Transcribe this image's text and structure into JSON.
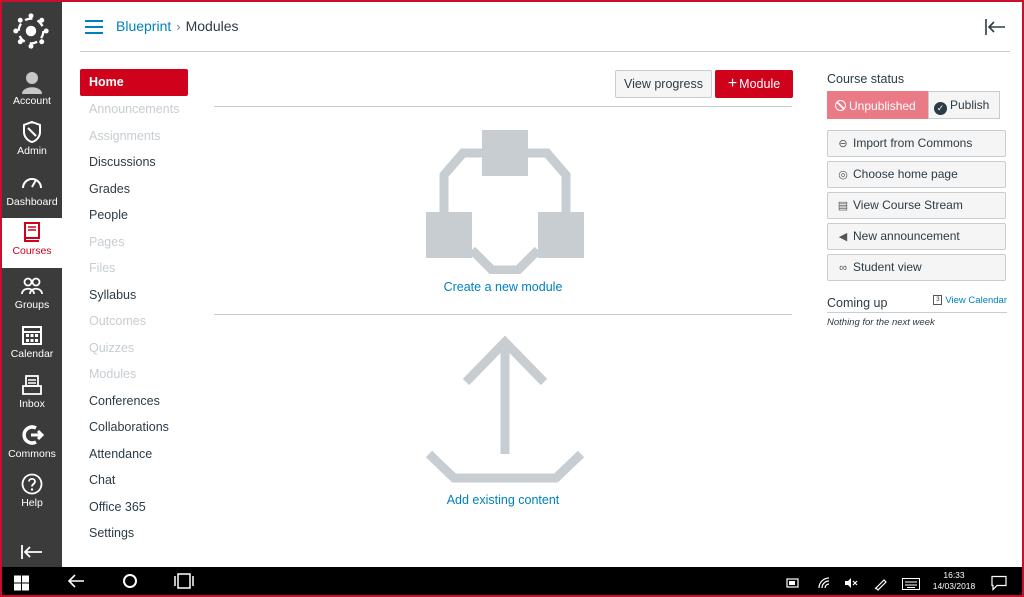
{
  "global_nav": {
    "items": [
      {
        "label": "Account",
        "icon": "user-icon"
      },
      {
        "label": "Admin",
        "icon": "shield-icon"
      },
      {
        "label": "Dashboard",
        "icon": "speedometer-icon"
      },
      {
        "label": "Courses",
        "icon": "book-icon"
      },
      {
        "label": "Groups",
        "icon": "group-icon"
      },
      {
        "label": "Calendar",
        "icon": "calendar-icon"
      },
      {
        "label": "Inbox",
        "icon": "inbox-icon"
      },
      {
        "label": "Commons",
        "icon": "commons-icon"
      },
      {
        "label": "Help",
        "icon": "help-icon"
      }
    ],
    "active": "Courses",
    "accent_color": "#d0021b"
  },
  "header": {
    "breadcrumb": [
      "Blueprint",
      "Modules"
    ]
  },
  "course_nav": {
    "items": [
      {
        "label": "Home",
        "state": "active"
      },
      {
        "label": "Announcements",
        "state": "hidden"
      },
      {
        "label": "Assignments",
        "state": "hidden"
      },
      {
        "label": "Discussions",
        "state": "visible"
      },
      {
        "label": "Grades",
        "state": "visible"
      },
      {
        "label": "People",
        "state": "visible"
      },
      {
        "label": "Pages",
        "state": "hidden"
      },
      {
        "label": "Files",
        "state": "hidden"
      },
      {
        "label": "Syllabus",
        "state": "visible"
      },
      {
        "label": "Outcomes",
        "state": "hidden"
      },
      {
        "label": "Quizzes",
        "state": "hidden"
      },
      {
        "label": "Modules",
        "state": "hidden"
      },
      {
        "label": "Conferences",
        "state": "visible"
      },
      {
        "label": "Collaborations",
        "state": "visible"
      },
      {
        "label": "Attendance",
        "state": "visible"
      },
      {
        "label": "Chat",
        "state": "visible"
      },
      {
        "label": "Office 365",
        "state": "visible"
      },
      {
        "label": "Settings",
        "state": "visible"
      }
    ]
  },
  "toolbar": {
    "view_progress": "View progress",
    "add_module": "Module"
  },
  "content": {
    "create_module": "Create a new module",
    "add_existing": "Add existing content"
  },
  "sidebar": {
    "course_status": "Course status",
    "unpublished": "Unpublished",
    "publish": "Publish",
    "buttons": [
      {
        "label": "Import from Commons",
        "icon": "commons-icon"
      },
      {
        "label": "Choose home page",
        "icon": "target-icon"
      },
      {
        "label": "View Course Stream",
        "icon": "stream-icon"
      },
      {
        "label": "New announcement",
        "icon": "megaphone-icon"
      },
      {
        "label": "Student view",
        "icon": "glasses-icon"
      }
    ],
    "coming_up": "Coming up",
    "view_calendar": "View Calendar",
    "calendar_glyph": "3",
    "nothing": "Nothing for the next week"
  },
  "taskbar": {
    "time": "16:33",
    "date": "14/03/2018"
  }
}
